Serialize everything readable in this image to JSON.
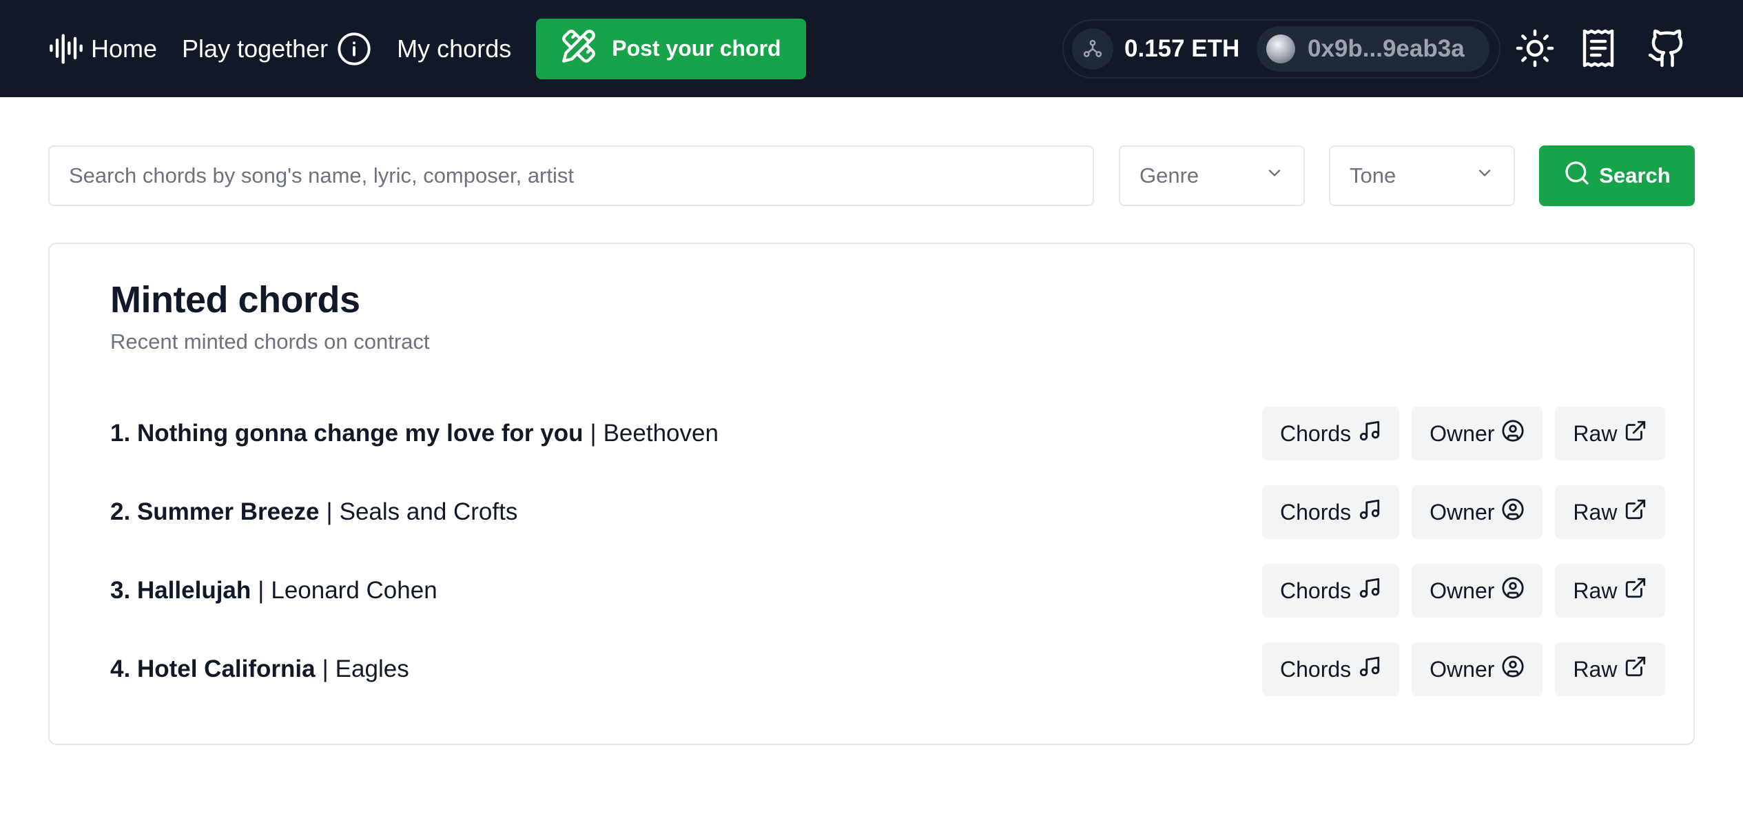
{
  "navbar": {
    "home_label": "Home",
    "play_label": "Play together",
    "mychords_label": "My chords",
    "post_label": "Post your chord",
    "balance": "0.157 ETH",
    "address": "0x9b...9eab3a"
  },
  "search": {
    "placeholder": "Search chords by song's name, lyric, composer, artist",
    "genre_label": "Genre",
    "tone_label": "Tone",
    "button_label": "Search"
  },
  "card": {
    "title": "Minted chords",
    "subtitle": "Recent minted chords on contract"
  },
  "songs": [
    {
      "num": "1.",
      "title": "Nothing gonna change my love for you",
      "artist": "Beethoven"
    },
    {
      "num": "2.",
      "title": "Summer Breeze",
      "artist": "Seals and Crofts"
    },
    {
      "num": "3.",
      "title": "Hallelujah",
      "artist": "Leonard Cohen"
    },
    {
      "num": "4.",
      "title": "Hotel California",
      "artist": "Eagles"
    }
  ],
  "row_actions": {
    "chords_label": "Chords",
    "owner_label": "Owner",
    "raw_label": "Raw",
    "separator": "|"
  },
  "icons": {
    "home": "waveform-icon",
    "play": "info-icon",
    "post": "pencil-ruler-icon",
    "network": "network-icon",
    "theme": "sun-icon",
    "docs": "receipt-icon",
    "github": "github-icon",
    "search": "search-icon",
    "chords": "music-icon",
    "owner": "user-circle-icon",
    "raw": "external-link-icon"
  },
  "colors": {
    "navbar_bg": "#111827",
    "accent_green": "#16a34a",
    "button_gray": "#f3f4f6"
  }
}
